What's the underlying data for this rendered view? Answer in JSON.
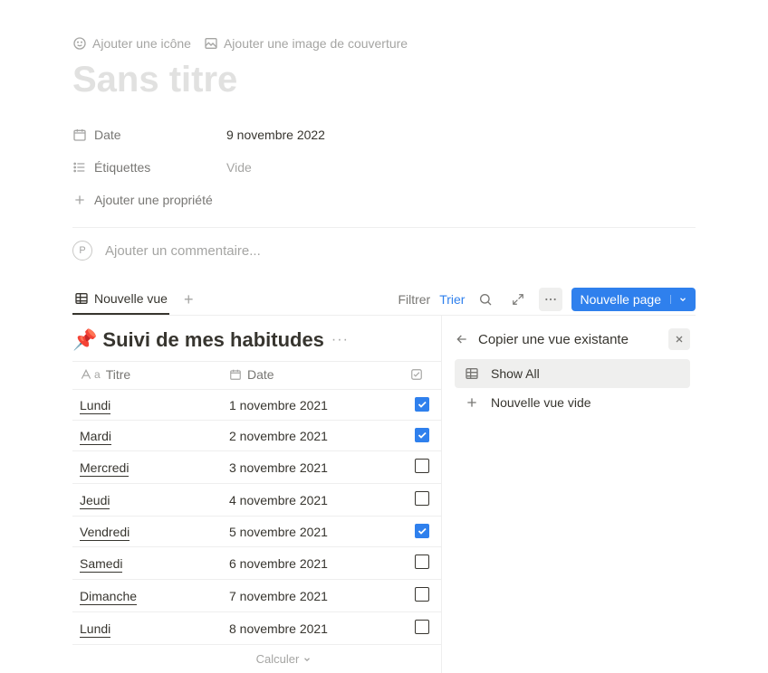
{
  "page_actions": {
    "add_icon": "Ajouter une icône",
    "add_cover": "Ajouter une image de couverture"
  },
  "page_title": "Sans titre",
  "properties": {
    "date_label": "Date",
    "date_value": "9 novembre 2022",
    "tags_label": "Étiquettes",
    "tags_value": "Vide",
    "add_property": "Ajouter une propriété"
  },
  "comment": {
    "avatar_letter": "P",
    "placeholder": "Ajouter un commentaire..."
  },
  "views": {
    "active_tab": "Nouvelle vue",
    "filter": "Filtrer",
    "sort": "Trier",
    "new_page": "Nouvelle page"
  },
  "database": {
    "emoji": "📌",
    "title": "Suivi de mes habitudes",
    "columns": {
      "title": "Titre",
      "date": "Date"
    },
    "rows": [
      {
        "title": "Lundi",
        "date": "1 novembre 2021",
        "checked": true
      },
      {
        "title": "Mardi",
        "date": "2 novembre 2021",
        "checked": true
      },
      {
        "title": "Mercredi",
        "date": "3 novembre 2021",
        "checked": false
      },
      {
        "title": "Jeudi",
        "date": "4 novembre 2021",
        "checked": false
      },
      {
        "title": "Vendredi",
        "date": "5 novembre 2021",
        "checked": true
      },
      {
        "title": "Samedi",
        "date": "6 novembre 2021",
        "checked": false
      },
      {
        "title": "Dimanche",
        "date": "7 novembre 2021",
        "checked": false
      },
      {
        "title": "Lundi",
        "date": "8 novembre 2021",
        "checked": false
      }
    ],
    "calculate": "Calculer"
  },
  "panel": {
    "title": "Copier une vue existante",
    "items": {
      "show_all": "Show All",
      "new_empty": "Nouvelle vue vide"
    }
  }
}
